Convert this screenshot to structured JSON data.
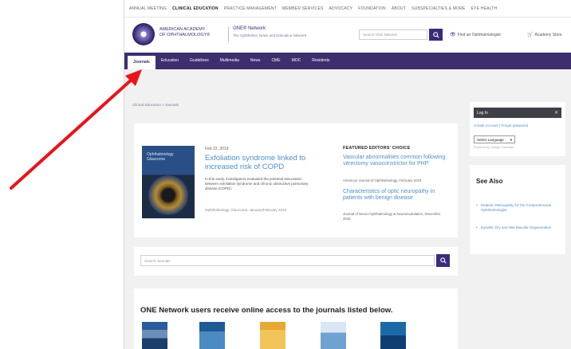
{
  "topnav": {
    "items": [
      "ANNUAL MEETING",
      "CLINICAL EDUCATION",
      "PRACTICE MANAGEMENT",
      "MEMBER SERVICES",
      "ADVOCACY",
      "FOUNDATION",
      "ABOUT",
      "SUBSPECIALTIES & MORE",
      "EYE HEALTH"
    ],
    "active_index": 1
  },
  "header": {
    "org_line1": "AMERICAN ACADEMY",
    "org_line2": "OF OPHTHALMOLOGY®",
    "title": "ONE® Network",
    "subtitle": "The Ophthalmic News and Education Network",
    "search_placeholder": "Search ONE Network",
    "link_patient": "Find an Ophthalmologist",
    "link_shopping": "Academy Store"
  },
  "mainnav": {
    "tabs": [
      "Journals",
      "Education",
      "Guidelines",
      "Multimedia",
      "News",
      "CME",
      "MOC",
      "Residents"
    ],
    "active_index": 0
  },
  "breadcrumb": "Clinical Education > Journals",
  "featured": {
    "date": "Feb 22, 2019",
    "title": "Exfoliation syndrome linked to increased risk of COPD",
    "body": "In this study, investigators evaluated the potential association between exfoliation syndrome and chronic obstructive pulmonary disease (COPD).",
    "source": "Ophthalmology, Glaucoma, January/February 2019",
    "cover_text": "Ophthalmology Glaucoma"
  },
  "editors_choice": {
    "heading": "FEATURED EDITORS' CHOICE",
    "items": [
      {
        "title": "Vascular abnormalities common following vitrectomy vasoconstrictor for PHP",
        "source": "American Journal of Ophthalmology, February 2019"
      },
      {
        "title": "Characteristics of optic neuropathy in patients with benign disease",
        "source": "Journal of Neuro-Ophthalmology & Neuromodulation, December 2018"
      }
    ]
  },
  "journal_search": {
    "placeholder": "Search Journals"
  },
  "journals": {
    "heading": "ONE Network users receive online access to the journals listed below."
  },
  "sidebar": {
    "login": "Log In",
    "links": "Create Account  |  Forgot password",
    "language": "Select Language",
    "language_sub": "Powered by Google Translate",
    "see_also": "See Also",
    "see_also_items": [
      "Diabetic Retinopathy for the Comprehensive Ophthalmologist",
      "Eyewiki: Dry and Wet Macular Degeneration"
    ]
  },
  "colors": {
    "purple": "#3e2e6e",
    "link_blue": "#4f8fc4",
    "arrow_red": "#e8141a"
  }
}
